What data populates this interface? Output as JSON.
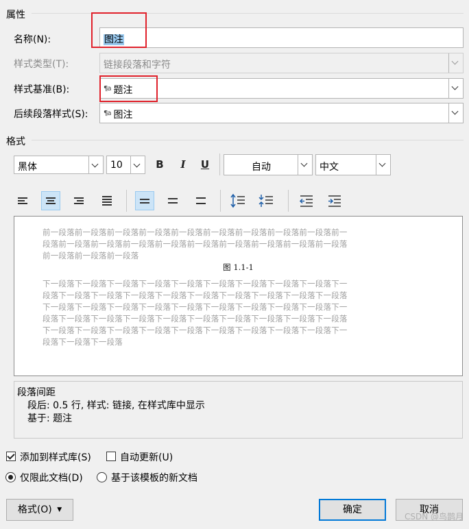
{
  "properties": {
    "section_title": "属性",
    "name_label": "名称(N):",
    "name_value": "图注",
    "style_type_label": "样式类型(T):",
    "style_type_value": "链接段落和字符",
    "style_based_label": "样式基准(B):",
    "style_based_value": "题注",
    "next_style_label": "后续段落样式(S):",
    "next_style_value": "图注",
    "para_icon_glyph": "¶a"
  },
  "format": {
    "section_title": "格式",
    "font_value": "黑体",
    "size_value": "10",
    "bold_glyph": "B",
    "italic_glyph": "I",
    "underline_glyph": "U",
    "color_value": "自动",
    "script_value": "中文"
  },
  "preview": {
    "prev_lines": [
      "前一段落前一段落前一段落前一段落前一段落前一段落前一段落前一段落前一段落前一",
      "段落前一段落前一段落前一段落前一段落前一段落前一段落前一段落前一段落前一段落",
      "前一段落前一段落前一段落"
    ],
    "sample": "图 1.1-1",
    "next_lines": [
      "下一段落下一段落下一段落下一段落下一段落下一段落下一段落下一段落下一段落下一",
      "段落下一段落下一段落下一段落下一段落下一段落下一段落下一段落下一段落下一段落",
      "下一段落下一段落下一段落下一段落下一段落下一段落下一段落下一段落下一段落下一",
      "段落下一段落下一段落下一段落下一段落下一段落下一段落下一段落下一段落下一段落",
      "下一段落下一段落下一段落下一段落下一段落下一段落下一段落下一段落下一段落下一",
      "段落下一段落下一段落"
    ]
  },
  "description": {
    "line1": "段落间距",
    "line2": "段后: 0.5 行, 样式: 链接, 在样式库中显示",
    "line3": "基于: 题注"
  },
  "options": {
    "add_to_gallery": "添加到样式库(S)",
    "add_to_gallery_checked": true,
    "auto_update": "自动更新(U)",
    "auto_update_checked": false,
    "this_doc_only": "仅限此文档(D)",
    "this_doc_only_selected": true,
    "new_docs_template": "基于该模板的新文档",
    "new_docs_template_selected": false
  },
  "buttons": {
    "format": "格式(O)",
    "ok": "确定",
    "cancel": "取消"
  },
  "watermark": "CSDN @鸟鹊月",
  "colors": {
    "accent": "#0078d7",
    "annotation_red": "#e0202a",
    "selection": "#99c9ef"
  }
}
